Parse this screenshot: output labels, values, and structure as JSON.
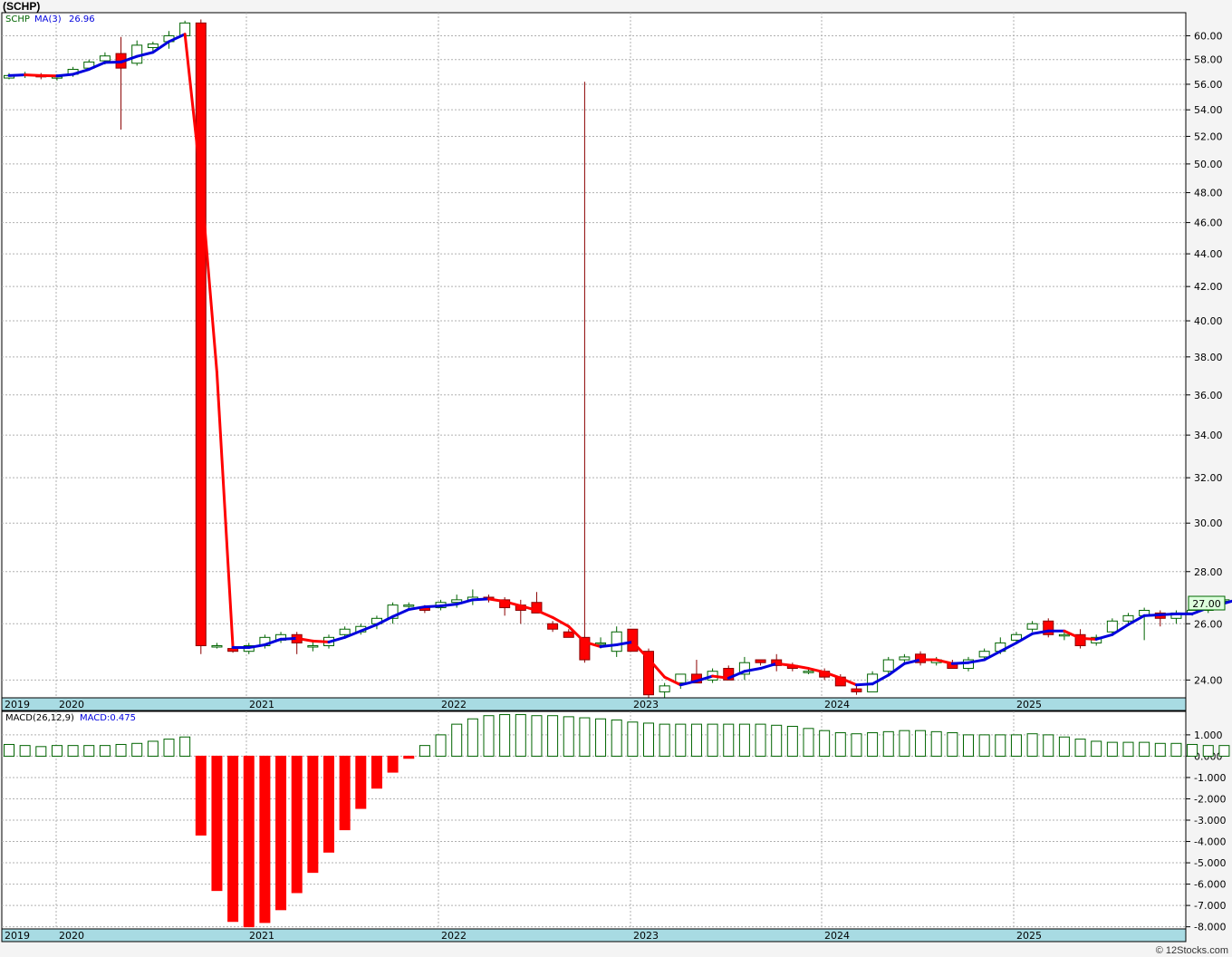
{
  "title": "(SCHP)",
  "watermark": "© 12Stocks.com",
  "colors": {
    "up_fill": "#ffffff",
    "up_stroke": "#006400",
    "down_fill": "#ff0000",
    "down_stroke": "#8b0000",
    "ma_up": "#0000dd",
    "ma_down": "#ff0000",
    "grid": "#b0b0b0",
    "date_band": "#a8dbe3",
    "macd_pos": "#006400",
    "macd_neg": "#ff0000"
  },
  "price_panel": {
    "legend_symbol": "SCHP",
    "legend_ma": "MA(3)",
    "legend_ma_value": "26.96",
    "last_price": "27.00"
  },
  "macd_panel": {
    "legend_macd": "MACD(26,12,9)",
    "legend_value": "MACD:0.475"
  },
  "chart_data": [
    {
      "type": "candlestick",
      "title": "(SCHP)",
      "scale": "log",
      "ylim": [
        23.4,
        62
      ],
      "yticks": [
        "24.00",
        "26.00",
        "28.00",
        "30.00",
        "32.00",
        "34.00",
        "36.00",
        "38.00",
        "40.00",
        "42.00",
        "44.00",
        "46.00",
        "48.00",
        "50.00",
        "52.00",
        "54.00",
        "56.00",
        "58.00",
        "60.00"
      ],
      "x_tick_labels": [
        "2019",
        "2020",
        "2021",
        "2022",
        "2023",
        "2024",
        "2025"
      ],
      "grid": true,
      "ohlc": [
        [
          56.5,
          56.9,
          56.4,
          56.7
        ],
        [
          56.7,
          57.0,
          56.5,
          56.8
        ],
        [
          56.7,
          56.9,
          56.4,
          56.6
        ],
        [
          56.5,
          56.8,
          56.3,
          56.6
        ],
        [
          56.8,
          57.4,
          56.6,
          57.2
        ],
        [
          57.3,
          58.0,
          57.1,
          57.8
        ],
        [
          57.9,
          58.6,
          57.6,
          58.3
        ],
        [
          58.5,
          59.9,
          52.5,
          57.3
        ],
        [
          57.7,
          59.6,
          57.5,
          59.2
        ],
        [
          59.0,
          59.5,
          58.7,
          59.3
        ],
        [
          59.5,
          60.4,
          58.9,
          60.0
        ],
        [
          60.0,
          61.3,
          59.8,
          61.1
        ],
        [
          61.1,
          61.4,
          24.9,
          25.2
        ],
        [
          25.2,
          25.3,
          25.1,
          25.2
        ],
        [
          25.1,
          25.2,
          24.95,
          25.0
        ],
        [
          25.0,
          25.3,
          24.9,
          25.2
        ],
        [
          25.2,
          25.6,
          25.1,
          25.5
        ],
        [
          25.4,
          25.7,
          25.3,
          25.6
        ],
        [
          25.6,
          25.7,
          24.9,
          25.3
        ],
        [
          25.2,
          25.4,
          25.0,
          25.2
        ],
        [
          25.2,
          25.6,
          25.1,
          25.5
        ],
        [
          25.6,
          25.9,
          25.5,
          25.8
        ],
        [
          25.7,
          26.0,
          25.6,
          25.9
        ],
        [
          26.0,
          26.3,
          25.8,
          26.2
        ],
        [
          26.2,
          26.8,
          26.0,
          26.7
        ],
        [
          26.7,
          26.8,
          26.5,
          26.7
        ],
        [
          26.6,
          26.7,
          26.4,
          26.5
        ],
        [
          26.6,
          26.9,
          26.5,
          26.8
        ],
        [
          26.8,
          27.1,
          26.6,
          26.9
        ],
        [
          26.9,
          27.3,
          26.7,
          27.0
        ],
        [
          27.0,
          27.1,
          26.8,
          26.9
        ],
        [
          26.9,
          27.0,
          26.3,
          26.6
        ],
        [
          26.7,
          26.9,
          26.0,
          26.5
        ],
        [
          26.8,
          27.2,
          26.4,
          26.4
        ],
        [
          26.0,
          26.1,
          25.7,
          25.8
        ],
        [
          25.7,
          25.8,
          25.5,
          25.5
        ],
        [
          25.5,
          56.2,
          24.6,
          24.7
        ],
        [
          25.3,
          25.5,
          25.1,
          25.3
        ],
        [
          25.0,
          25.9,
          24.8,
          25.7
        ],
        [
          25.8,
          25.8,
          25.0,
          25.0
        ],
        [
          25.0,
          25.1,
          23.4,
          23.5
        ],
        [
          23.6,
          23.9,
          23.4,
          23.8
        ],
        [
          23.9,
          24.2,
          23.7,
          24.2
        ],
        [
          24.2,
          24.7,
          23.9,
          23.9
        ],
        [
          24.0,
          24.4,
          23.9,
          24.3
        ],
        [
          24.4,
          24.5,
          24.0,
          24.0
        ],
        [
          24.2,
          24.8,
          24.0,
          24.6
        ],
        [
          24.7,
          24.7,
          24.5,
          24.6
        ],
        [
          24.7,
          24.9,
          24.3,
          24.5
        ],
        [
          24.5,
          24.6,
          24.3,
          24.4
        ],
        [
          24.3,
          24.4,
          24.2,
          24.3
        ],
        [
          24.3,
          24.4,
          24.0,
          24.1
        ],
        [
          24.1,
          24.2,
          23.8,
          23.8
        ],
        [
          23.7,
          23.8,
          23.5,
          23.6
        ],
        [
          23.6,
          24.3,
          23.6,
          24.2
        ],
        [
          24.3,
          24.8,
          24.2,
          24.7
        ],
        [
          24.7,
          24.9,
          24.6,
          24.8
        ],
        [
          24.9,
          25.0,
          24.5,
          24.6
        ],
        [
          24.6,
          24.8,
          24.5,
          24.7
        ],
        [
          24.6,
          24.7,
          24.4,
          24.4
        ],
        [
          24.4,
          24.8,
          24.3,
          24.7
        ],
        [
          24.8,
          25.1,
          24.7,
          25.0
        ],
        [
          25.0,
          25.5,
          24.9,
          25.3
        ],
        [
          25.4,
          25.7,
          25.3,
          25.6
        ],
        [
          25.8,
          26.1,
          25.7,
          26.0
        ],
        [
          26.1,
          26.2,
          25.5,
          25.6
        ],
        [
          25.6,
          25.7,
          25.4,
          25.6
        ],
        [
          25.6,
          25.8,
          25.1,
          25.2
        ],
        [
          25.3,
          25.6,
          25.2,
          25.5
        ],
        [
          25.7,
          26.2,
          25.6,
          26.1
        ],
        [
          26.1,
          26.4,
          26.0,
          26.3
        ],
        [
          26.3,
          26.6,
          25.4,
          26.5
        ],
        [
          26.4,
          26.5,
          25.9,
          26.2
        ],
        [
          26.2,
          26.5,
          26.0,
          26.4
        ],
        [
          26.4,
          26.6,
          26.3,
          26.5
        ],
        [
          26.5,
          27.0,
          26.4,
          26.9
        ],
        [
          26.9,
          27.0,
          26.8,
          26.9
        ],
        [
          26.9,
          27.1,
          26.8,
          27.0
        ],
        [
          26.9,
          27.1,
          26.9,
          27.0
        ]
      ]
    },
    {
      "type": "bar",
      "title": "MACD(26,12,9)",
      "ylim": [
        -8.1,
        2.1
      ],
      "yticks": [
        "-8.000",
        "-7.000",
        "-6.000",
        "-5.000",
        "-4.000",
        "-3.000",
        "-2.000",
        "-1.000",
        "0.000",
        "1.000"
      ],
      "x_tick_labels": [
        "2019",
        "2020",
        "2021",
        "2022",
        "2023",
        "2024",
        "2025"
      ],
      "values": [
        0.55,
        0.5,
        0.45,
        0.5,
        0.5,
        0.5,
        0.5,
        0.55,
        0.6,
        0.7,
        0.8,
        0.9,
        -3.7,
        -6.3,
        -7.75,
        -8.0,
        -7.8,
        -7.2,
        -6.4,
        -5.45,
        -4.5,
        -3.45,
        -2.45,
        -1.5,
        -0.75,
        -0.1,
        0.5,
        1.0,
        1.5,
        1.75,
        1.9,
        1.95,
        1.95,
        1.9,
        1.9,
        1.85,
        1.8,
        1.75,
        1.7,
        1.6,
        1.55,
        1.5,
        1.5,
        1.5,
        1.5,
        1.5,
        1.5,
        1.5,
        1.45,
        1.4,
        1.3,
        1.2,
        1.1,
        1.05,
        1.1,
        1.15,
        1.2,
        1.2,
        1.15,
        1.1,
        1.0,
        1.0,
        1.0,
        1.0,
        1.05,
        1.0,
        0.9,
        0.8,
        0.7,
        0.65,
        0.65,
        0.65,
        0.6,
        0.6,
        0.55,
        0.5,
        0.5,
        0.5,
        0.5
      ]
    }
  ]
}
